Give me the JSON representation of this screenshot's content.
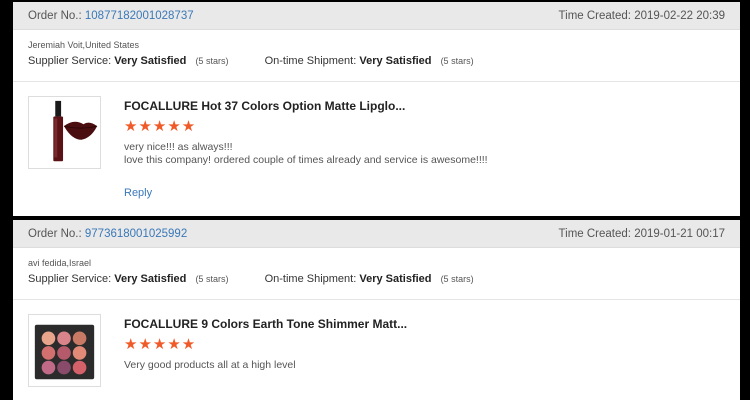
{
  "labels": {
    "order_no": "Order No.:",
    "time_created": "Time Created:",
    "supplier_service": "Supplier Service:",
    "ontime_shipment": "On-time Shipment:"
  },
  "reviews": [
    {
      "order_no": "10877182001028737",
      "time_created": "2019-02-22 20:39",
      "buyer": "Jeremiah Voit,United States",
      "supplier_rating": "Very Satisfied",
      "supplier_stars": "(5 stars)",
      "shipment_rating": "Very Satisfied",
      "shipment_stars": "(5 stars)",
      "product_title": "FOCALLURE Hot 37 Colors Option Matte Lipglo...",
      "product_image": "lipgloss-product-image",
      "rating": 5,
      "stars": "★★★★★",
      "comment_lines": [
        "very nice!!! as always!!!",
        "love this company! ordered couple of times already and service is awesome!!!!"
      ],
      "reply_label": "Reply"
    },
    {
      "order_no": "9773618001025992",
      "time_created": "2019-01-21 00:17",
      "buyer": "avi fedida,Israel",
      "supplier_rating": "Very Satisfied",
      "supplier_stars": "(5 stars)",
      "shipment_rating": "Very Satisfied",
      "shipment_stars": "(5 stars)",
      "product_title": "FOCALLURE 9 Colors Earth Tone Shimmer Matt...",
      "product_image": "eyeshadow-palette-image",
      "rating": 5,
      "stars": "★★★★★",
      "comment_lines": [
        "Very good products all at a high level"
      ]
    }
  ],
  "colors": {
    "link": "#3a78b8",
    "star": "#f05a28",
    "header_bg": "#e9e9e9"
  }
}
